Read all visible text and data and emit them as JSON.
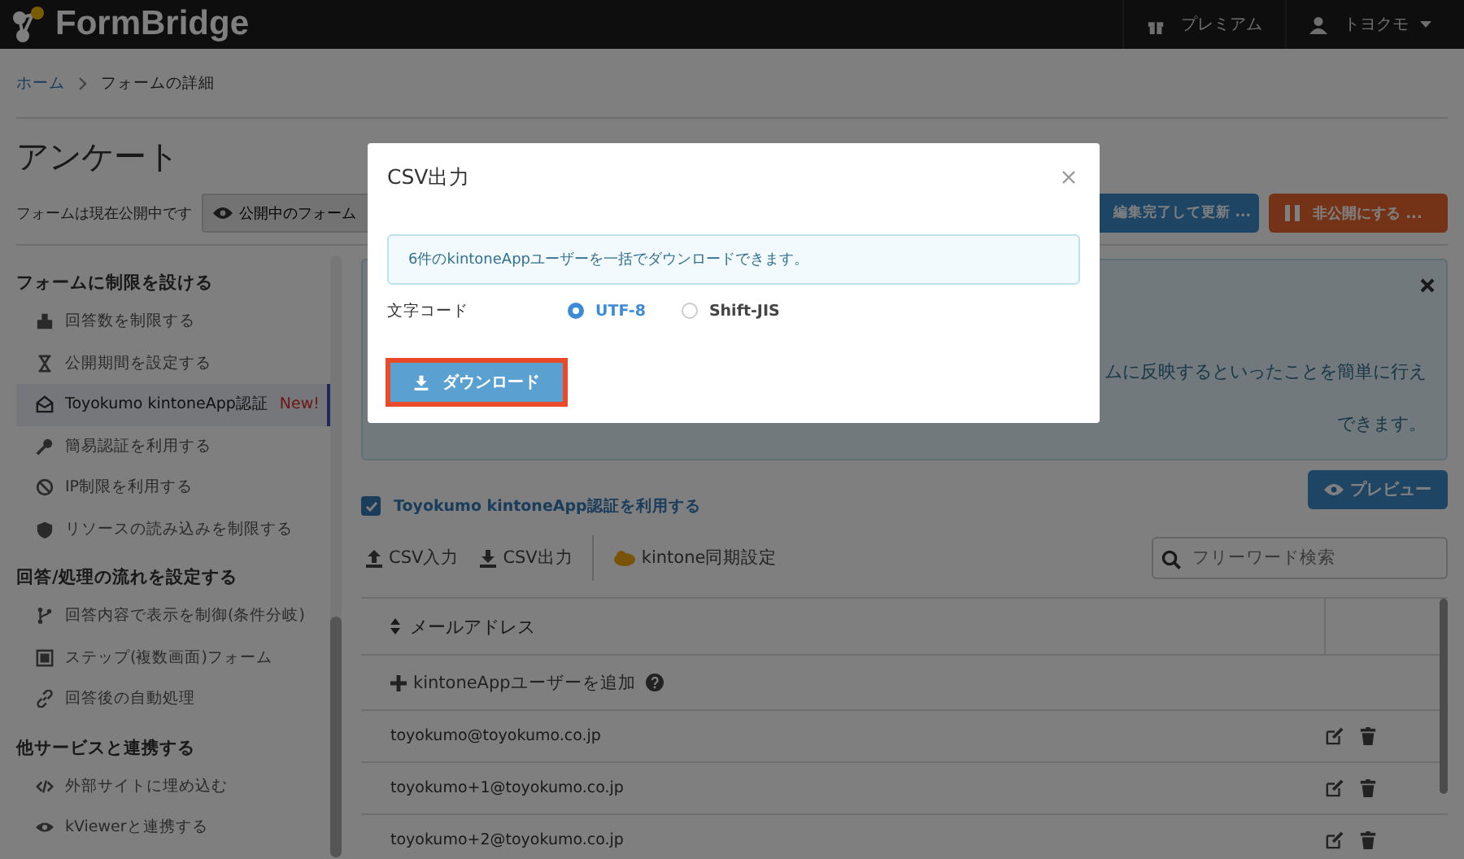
{
  "header": {
    "logo": "FormBridge",
    "premium": "プレミアム",
    "user": "トヨクモ"
  },
  "breadcrumb": [
    "ホーム",
    "フォームの詳細"
  ],
  "page_title": "アンケート",
  "status": {
    "text": "フォームは現在公開中です",
    "view_button": "公開中のフォーム",
    "update_button": "編集完了して更新 ...",
    "unpublish_button": "非公開にする ..."
  },
  "sidebar": {
    "sections": [
      {
        "title": "フォームに制限を設ける",
        "items": [
          {
            "label": "回答数を制限する",
            "selected": false
          },
          {
            "label": "公開期間を設定する",
            "selected": false
          },
          {
            "label": "Toyokumo kintoneApp認証",
            "selected": true,
            "badge": "New!"
          },
          {
            "label": "簡易認証を利用する",
            "selected": false
          },
          {
            "label": "IP制限を利用する",
            "selected": false
          },
          {
            "label": "リソースの読み込みを制限する",
            "selected": false
          }
        ]
      },
      {
        "title": "回答/処理の流れを設定する",
        "items": [
          {
            "label": "回答内容で表示を制御(条件分岐)",
            "selected": false
          },
          {
            "label": "ステップ(複数画面)フォーム",
            "selected": false
          },
          {
            "label": "回答後の自動処理",
            "selected": false
          }
        ]
      },
      {
        "title": "他サービスと連携する",
        "items": [
          {
            "label": "外部サイトに埋め込む",
            "selected": false
          },
          {
            "label": "kViewerと連携する",
            "selected": false
          }
        ]
      }
    ]
  },
  "info_panel": {
    "lines": [
      "ムに反映するといったことを簡単に行え",
      "できます。"
    ]
  },
  "enable_checkbox": {
    "label": "Toyokumo kintoneApp認証を利用する",
    "checked": true
  },
  "preview_button": "プレビュー",
  "toolbar": {
    "items": [
      "CSV入力",
      "CSV出力",
      "kintone同期設定"
    ],
    "search_placeholder": "フリーワード検索"
  },
  "table": {
    "column": "メールアドレス",
    "add_row": "kintoneAppユーザーを追加",
    "rows": [
      "toyokumo@toyokumo.co.jp",
      "toyokumo+1@toyokumo.co.jp",
      "toyokumo+2@toyokumo.co.jp"
    ]
  },
  "dialog": {
    "title": "CSV出力",
    "message": "6件のkintoneAppユーザーを一括でダウンロードできます。",
    "encoding_label": "文字コード",
    "encodings": [
      {
        "label": "UTF-8",
        "selected": true
      },
      {
        "label": "Shift-JIS",
        "selected": false
      }
    ],
    "download_button": "ダウンロード"
  }
}
